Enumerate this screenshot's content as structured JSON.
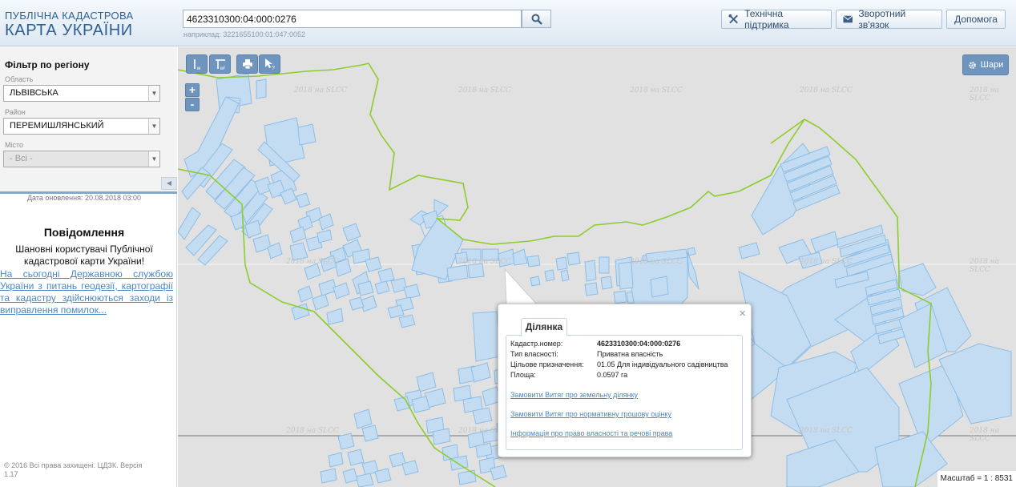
{
  "header": {
    "logo_line1": "ПУБЛІЧНА КАДАСТРОВА",
    "logo_line2": "КАРТА УКРАЇНИ",
    "search_value": "4623310300:04:000:0276",
    "search_hint": "наприклад: 3221655100:01:047:0052",
    "support_label": "Технічна підтримка",
    "feedback_label": "Зворотний зв'язок",
    "help_label": "Допомога"
  },
  "sidebar": {
    "filter_title": "Фільтр по регіону",
    "oblast_label": "Область",
    "oblast_value": "ЛЬВІВСЬКА",
    "raion_label": "Район",
    "raion_value": "ПЕРЕМИШЛЯНСЬКИЙ",
    "city_label": "Місто",
    "city_value": "- Всі -",
    "update_date": "Дата оновлення: 20.08.2018 03:00",
    "messages_title": "Повідомлення",
    "messages_text": "Шановні користувачі Публічної кадастрової карти України!",
    "messages_link": "На сьогодні Державною службою України з питань геодезії, картографії та кадастру здійснюються заходи із виправлення помилок...",
    "copyright": "© 2016 Всі права захищені. ЦДЗК. Версія 1.17"
  },
  "map": {
    "layers_label": "Шари",
    "zoom_in": "+",
    "zoom_out": "-",
    "watermark": "2018 на SLCC",
    "scale": "Масштаб = 1 : 8531",
    "colors": {
      "parcel_fill": "#c4dcf1",
      "parcel_stroke": "#8cbde6",
      "boundary": "#8ccc2c",
      "toolbar": "#6f95bf"
    }
  },
  "popup": {
    "tab_label": "Ділянка",
    "rows": [
      {
        "key": "Кадастр.номер:",
        "value": "4623310300:04:000:0276"
      },
      {
        "key": "Тип власності:",
        "value": "Приватна власність"
      },
      {
        "key": "Цільове призначення:",
        "value": "01.05 Для індивідуального садівництва"
      },
      {
        "key": "Площа:",
        "value": "0.0597 га"
      }
    ],
    "links": [
      "Замовити Витяг про земельну ділянку",
      "Замовити Витяг про нормативну грошову оцінку",
      "Інформація про право власності та речові права"
    ]
  }
}
